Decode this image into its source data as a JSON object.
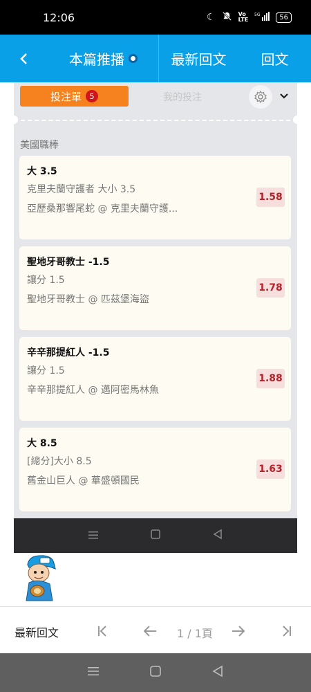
{
  "status": {
    "time": "12:06",
    "battery": "56"
  },
  "topnav": {
    "push_label": "本篇推播",
    "latest_label": "最新回文",
    "reply_label": "回文"
  },
  "embed": {
    "bet_slip_label": "投注單",
    "bet_slip_count": "5",
    "my_bets_label": "我的投注",
    "league": "美國職棒",
    "cards": [
      {
        "title": "大 3.5",
        "line": "克里夫蘭守護者 大小 3.5",
        "match": "亞歷桑那響尾蛇 @ 克里夫蘭守護...",
        "odds": "1.58"
      },
      {
        "title": "聖地牙哥教士 -1.5",
        "line": "讓分 1.5",
        "match": "聖地牙哥教士 @ 匹茲堡海盜",
        "odds": "1.78"
      },
      {
        "title": "辛辛那提紅人 -1.5",
        "line": "讓分 1.5",
        "match": "辛辛那提紅人 @ 邁阿密馬林魚",
        "odds": "1.88"
      },
      {
        "title": "大 8.5",
        "line": "[總分]大小 8.5",
        "match": "舊金山巨人 @ 華盛頓國民",
        "odds": "1.63"
      }
    ]
  },
  "pager": {
    "label": "最新回文",
    "page": "1 / 1頁"
  },
  "colors": {
    "nav_blue": "#0aa0e8",
    "bet_orange": "#f5821f",
    "odds_red": "#b4232a"
  }
}
